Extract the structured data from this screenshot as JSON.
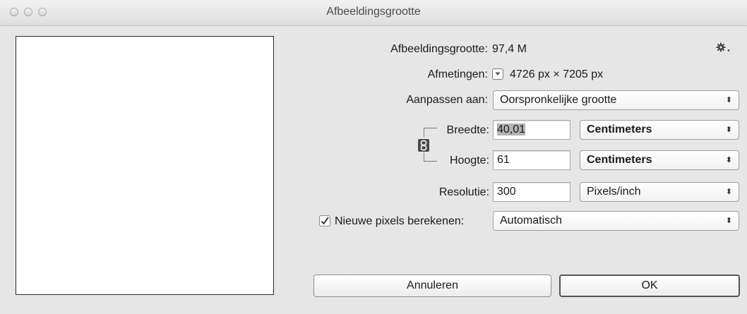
{
  "window": {
    "title": "Afbeeldingsgrootte"
  },
  "size": {
    "label": "Afbeeldingsgrootte:",
    "value": "97,4 M"
  },
  "dimensions": {
    "label": "Afmetingen:",
    "value": "4726 px  ×  7205 px"
  },
  "fit_to": {
    "label": "Aanpassen aan:",
    "selected": "Oorspronkelijke grootte"
  },
  "width": {
    "label": "Breedte:",
    "value": "40,01",
    "unit": "Centimeters"
  },
  "height": {
    "label": "Hoogte:",
    "value": "61",
    "unit": "Centimeters"
  },
  "resolution": {
    "label": "Resolutie:",
    "value": "300",
    "unit": "Pixels/inch"
  },
  "resample": {
    "label": "Nieuwe pixels berekenen:",
    "checked": true,
    "selected": "Automatisch"
  },
  "buttons": {
    "cancel": "Annuleren",
    "ok": "OK"
  },
  "icons": {
    "gear": "gear-icon",
    "dimensions_dropdown": "triangle-down-icon",
    "constrain": "chain-link-icon",
    "popup_arrows": "updown-arrows-icon",
    "checkmark": "checkmark-icon"
  }
}
